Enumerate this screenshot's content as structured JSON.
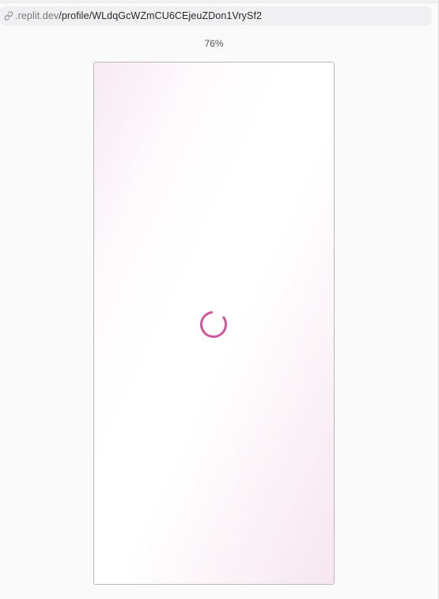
{
  "address_bar": {
    "icon": "link-icon",
    "domain": ".replit.dev",
    "path": "/profile/WLdqGcWZmCU6CEjeuZDon1VrySf2"
  },
  "zoom_level": "76%",
  "preview": {
    "state": "loading",
    "spinner_icon": "spinner-icon",
    "accent_color": "#d2569a"
  }
}
